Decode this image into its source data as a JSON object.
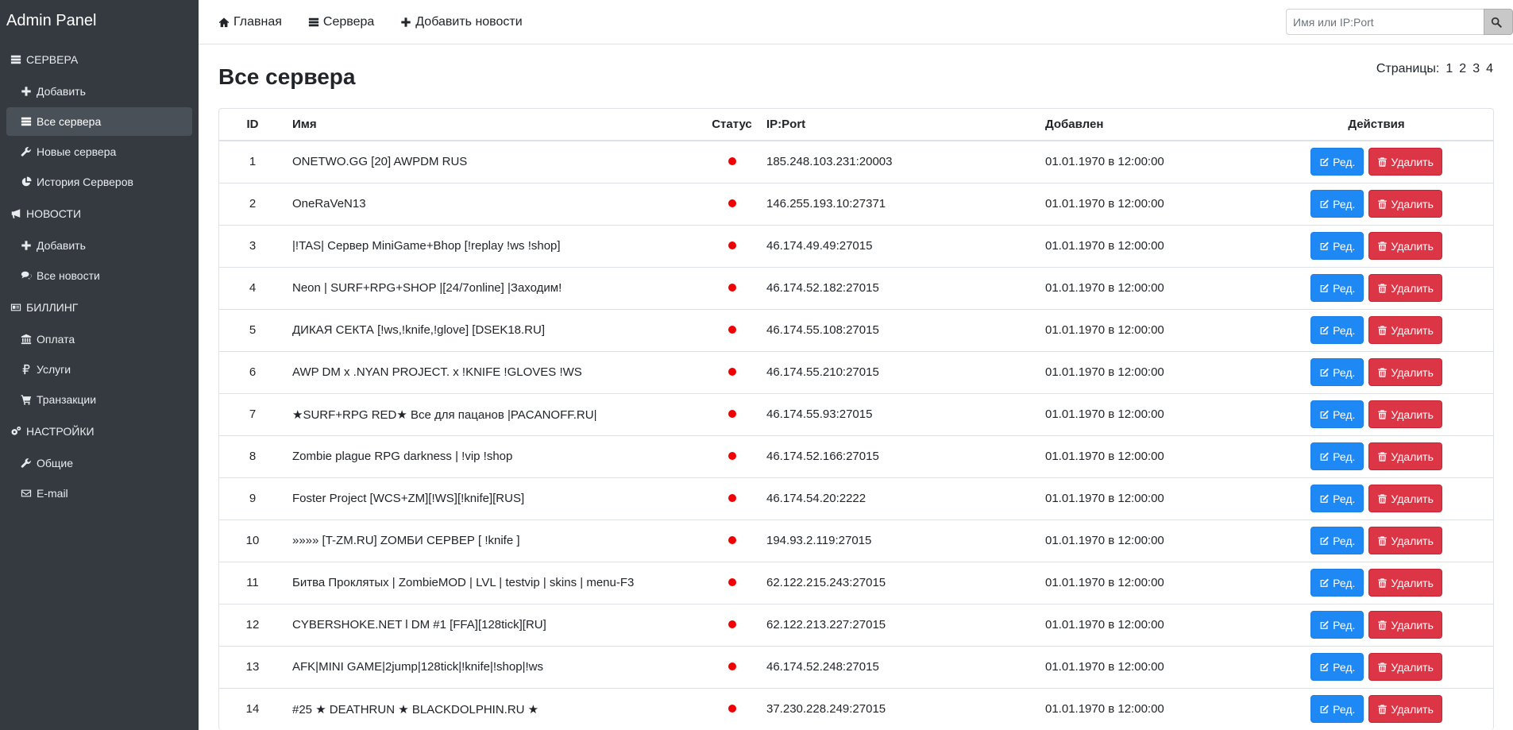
{
  "app": {
    "brand": "Admin Panel"
  },
  "sidebar": {
    "sections": [
      {
        "label": "СЕРВЕРА",
        "icon": "server-icon",
        "items": [
          {
            "label": "Добавить",
            "icon": "plus-icon",
            "active": false
          },
          {
            "label": "Все сервера",
            "icon": "server-icon",
            "active": true
          },
          {
            "label": "Новые сервера",
            "icon": "wrench-icon",
            "active": false
          },
          {
            "label": "История Серверов",
            "icon": "pie-chart-icon",
            "active": false
          }
        ]
      },
      {
        "label": "НОВОСТИ",
        "icon": "bullhorn-icon",
        "items": [
          {
            "label": "Добавить",
            "icon": "plus-icon",
            "active": false
          },
          {
            "label": "Все новости",
            "icon": "comments-icon",
            "active": false
          }
        ]
      },
      {
        "label": "БИЛЛИНГ",
        "icon": "id-card-icon",
        "items": [
          {
            "label": "Оплата",
            "icon": "bank-icon",
            "active": false
          },
          {
            "label": "Услуги",
            "icon": "ruble-icon",
            "active": false
          },
          {
            "label": "Транзакции",
            "icon": "cart-icon",
            "active": false
          }
        ]
      },
      {
        "label": "НАСТРОЙКИ",
        "icon": "cogs-icon",
        "items": [
          {
            "label": "Общие",
            "icon": "wrench-icon",
            "active": false
          },
          {
            "label": "E-mail",
            "icon": "envelope-icon",
            "active": false
          }
        ]
      }
    ]
  },
  "topbar": {
    "links": [
      {
        "label": "Главная",
        "icon": "home-icon"
      },
      {
        "label": "Сервера",
        "icon": "server-icon"
      },
      {
        "label": "Добавить новости",
        "icon": "plus-icon"
      }
    ],
    "search": {
      "placeholder": "Имя или IP:Port",
      "value": "",
      "icon": "search-icon"
    }
  },
  "main": {
    "title": "Все сервера",
    "pagination": {
      "label": "Страницы:",
      "pages": [
        "1",
        "2",
        "3",
        "4"
      ]
    },
    "table": {
      "headers": {
        "id": "ID",
        "name": "Имя",
        "status": "Статус",
        "ip": "IP:Port",
        "added": "Добавлен",
        "actions": "Действия"
      },
      "status_color": "#f00000",
      "edit_label": "Ред.",
      "delete_label": "Удалить",
      "edit_color": "#1e88f5",
      "delete_color": "#dc3545",
      "rows": [
        {
          "id": "1",
          "name": "ONETWO.GG [20] AWPDM RUS",
          "status": "offline",
          "ip": "185.248.103.231:20003",
          "added": "01.01.1970 в 12:00:00"
        },
        {
          "id": "2",
          "name": "OneRaVeN13",
          "status": "offline",
          "ip": "146.255.193.10:27371",
          "added": "01.01.1970 в 12:00:00"
        },
        {
          "id": "3",
          "name": "|!TAS| Сервер MiniGame+Bhop [!replay !ws !shop]",
          "status": "offline",
          "ip": "46.174.49.49:27015",
          "added": "01.01.1970 в 12:00:00"
        },
        {
          "id": "4",
          "name": "Neon | SURF+RPG+SHOP |[24/7online] |Заходим!",
          "status": "offline",
          "ip": "46.174.52.182:27015",
          "added": "01.01.1970 в 12:00:00"
        },
        {
          "id": "5",
          "name": "ДИКАЯ СЕКТА [!ws,!knife,!glove] [DSEK18.RU]",
          "status": "offline",
          "ip": "46.174.55.108:27015",
          "added": "01.01.1970 в 12:00:00"
        },
        {
          "id": "6",
          "name": "AWP DM x .NYAN PROJECT. x !KNIFE !GLOVES !WS",
          "status": "offline",
          "ip": "46.174.55.210:27015",
          "added": "01.01.1970 в 12:00:00"
        },
        {
          "id": "7",
          "name": "★SURF+RPG RED★ Все для пацанов |PACANOFF.RU|",
          "status": "offline",
          "ip": "46.174.55.93:27015",
          "added": "01.01.1970 в 12:00:00"
        },
        {
          "id": "8",
          "name": "Zombie plague RPG darkness | !vip !shop",
          "status": "offline",
          "ip": "46.174.52.166:27015",
          "added": "01.01.1970 в 12:00:00"
        },
        {
          "id": "9",
          "name": "Foster Project [WCS+ZM][!WS][!knife][RUS]",
          "status": "offline",
          "ip": "46.174.54.20:2222",
          "added": "01.01.1970 в 12:00:00"
        },
        {
          "id": "10",
          "name": "»»»» [T-ZM.RU] ZОМБИ СЕРВЕР [ !knife ]",
          "status": "offline",
          "ip": "194.93.2.119:27015",
          "added": "01.01.1970 в 12:00:00"
        },
        {
          "id": "11",
          "name": "Битва Проклятых | ZombieMOD | LVL | testvip | skins | menu-F3",
          "status": "offline",
          "ip": "62.122.215.243:27015",
          "added": "01.01.1970 в 12:00:00"
        },
        {
          "id": "12",
          "name": "CYBERSHOKE.NET l DM #1 [FFA][128tick][RU]",
          "status": "offline",
          "ip": "62.122.213.227:27015",
          "added": "01.01.1970 в 12:00:00"
        },
        {
          "id": "13",
          "name": "AFK|MINI GAME|2jump|128tick|!knife|!shop|!ws",
          "status": "offline",
          "ip": "46.174.52.248:27015",
          "added": "01.01.1970 в 12:00:00"
        },
        {
          "id": "14",
          "name": "#25 ★ DEATHRUN ★ BLACKDOLPHIN.RU ★",
          "status": "offline",
          "ip": "37.230.228.249:27015",
          "added": "01.01.1970 в 12:00:00"
        }
      ]
    }
  }
}
